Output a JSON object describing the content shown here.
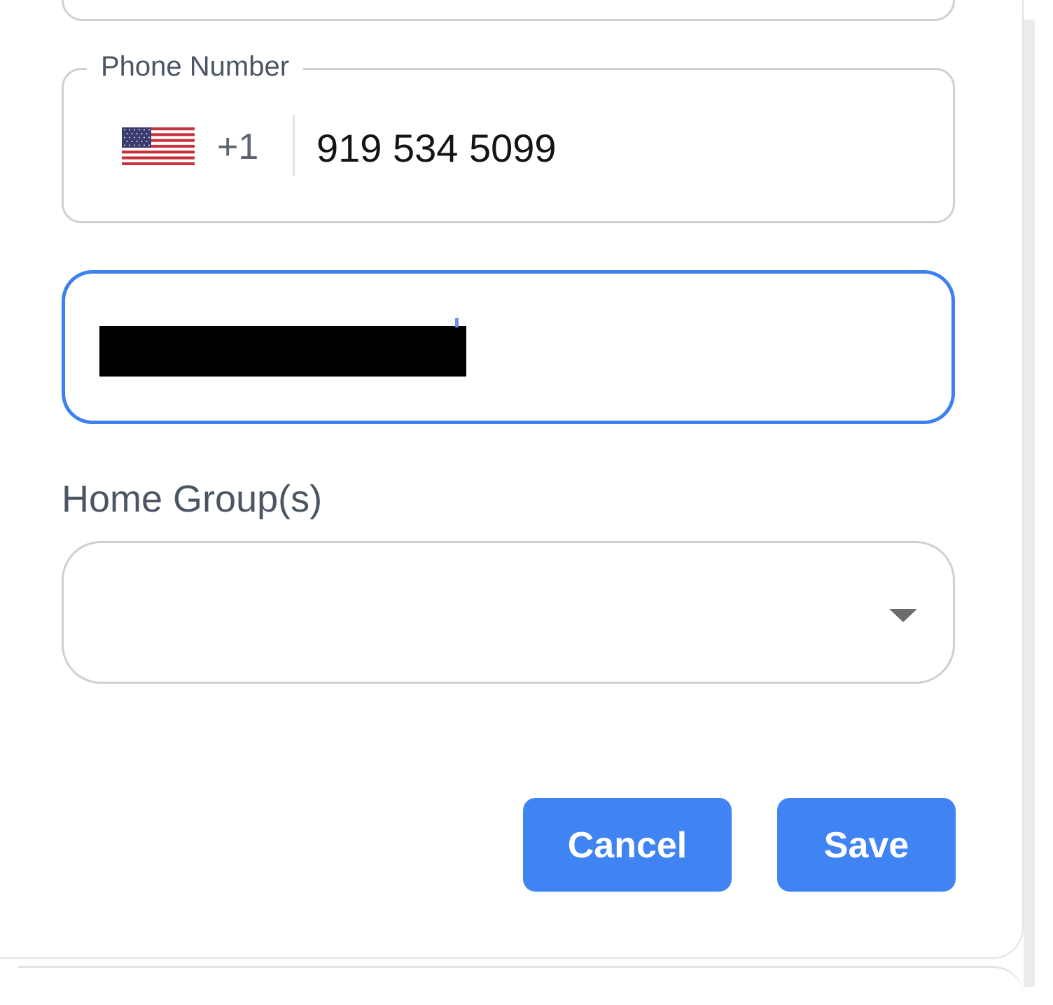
{
  "form": {
    "phone": {
      "legend": "Phone Number",
      "country_icon": "us-flag-icon",
      "dial_code": "+1",
      "value": "919 534 5099"
    },
    "focused_field": {
      "value": ""
    },
    "home_groups": {
      "label": "Home Group(s)",
      "selected": "",
      "dropdown_icon": "caret-down-icon"
    }
  },
  "actions": {
    "cancel_label": "Cancel",
    "save_label": "Save"
  },
  "colors": {
    "accent": "#4084f4",
    "focus_border": "#3d80f0",
    "field_border": "#cfd0d3",
    "label_text": "#4b5563",
    "input_text": "#141414"
  }
}
